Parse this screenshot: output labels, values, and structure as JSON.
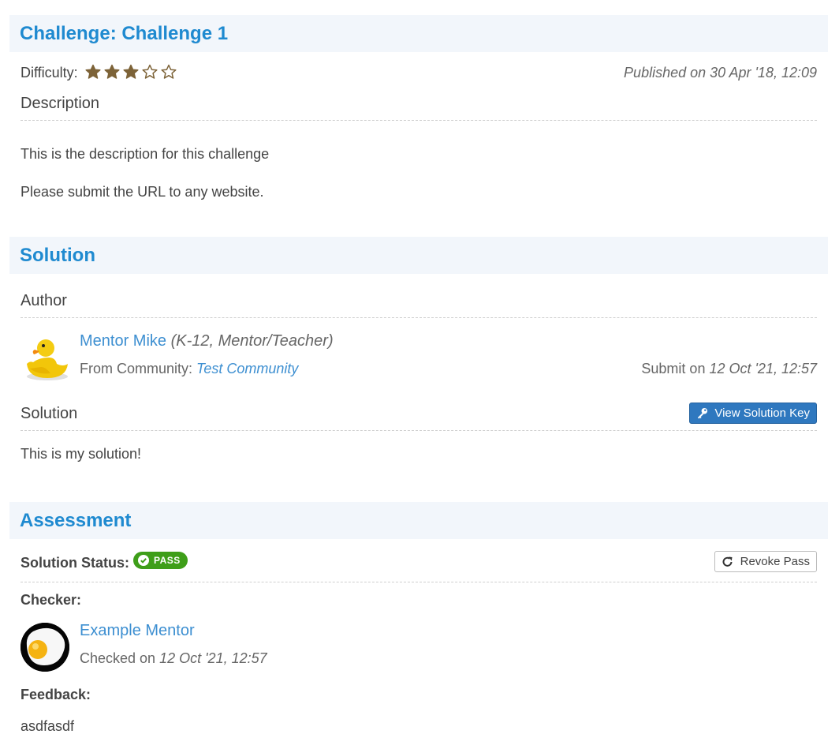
{
  "challenge": {
    "header": "Challenge: Challenge 1",
    "difficulty_label": "Difficulty:",
    "difficulty_rating": 3,
    "difficulty_max": 5,
    "published": "Published on 30 Apr '18, 12:09",
    "description_heading": "Description",
    "description_lines": [
      "This is the description for this challenge",
      "Please submit the URL to any website."
    ]
  },
  "solution": {
    "header": "Solution",
    "author_heading": "Author",
    "author_name": "Mentor Mike",
    "author_role": "(K-12, Mentor/Teacher)",
    "community_label": "From Community:",
    "community_name": "Test Community",
    "submit_label": "Submit on",
    "submit_date": "12 Oct '21, 12:57",
    "solution_heading": "Solution",
    "view_key_button": "View Solution Key",
    "solution_text": "This is my solution!",
    "author_avatar_icon": "rubber-duck-avatar"
  },
  "assessment": {
    "header": "Assessment",
    "status_label": "Solution Status:",
    "status_badge": "PASS",
    "revoke_button": "Revoke Pass",
    "checker_label": "Checker:",
    "checker_name": "Example Mentor",
    "checked_label": "Checked on",
    "checked_date": "12 Oct '21, 12:57",
    "feedback_label": "Feedback:",
    "feedback_text": "asdfasdf",
    "checker_avatar_icon": "fried-egg-avatar"
  },
  "colors": {
    "heading_blue": "#1f8ad0",
    "link_blue": "#3d8fd1",
    "star_brown": "#7d6338",
    "pass_green": "#3e9e19",
    "button_blue": "#2f78bf",
    "header_bg": "#f2f6fb"
  }
}
